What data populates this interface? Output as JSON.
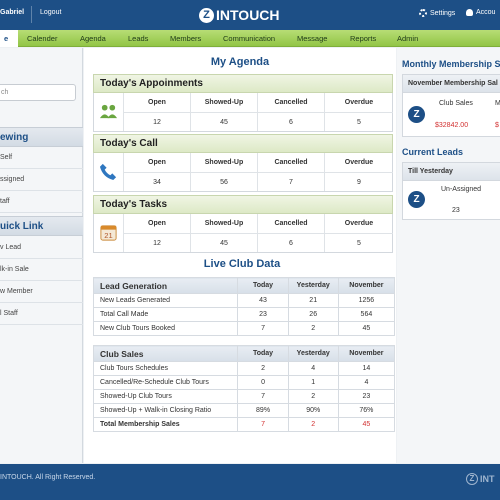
{
  "topbar": {
    "user": "Gabriel",
    "logout": "Logout",
    "logo_mark": "Z",
    "logo": "INTOUCH",
    "settings": "Settings",
    "account": "Accou"
  },
  "nav": [
    {
      "label": "e"
    },
    {
      "label": "Calender"
    },
    {
      "label": "Agenda"
    },
    {
      "label": "Leads"
    },
    {
      "label": "Members"
    },
    {
      "label": "Communication"
    },
    {
      "label": "Message"
    },
    {
      "label": "Reports"
    },
    {
      "label": "Admin"
    }
  ],
  "sidebar": {
    "search_placeholder": "ch",
    "viewing_title": "ewing",
    "viewing_items": [
      "Self",
      "ssigned",
      "taff"
    ],
    "quick_title": "uick Link",
    "quick_items": [
      "v Lead",
      "lk-in Sale",
      "w Member",
      "l Staff"
    ]
  },
  "main": {
    "title": "My Agenda",
    "appointments": {
      "title": "Today's Appoinments",
      "headers": [
        "Open",
        "Showed-Up",
        "Cancelled",
        "Overdue"
      ],
      "values": [
        "12",
        "45",
        "6",
        "5"
      ]
    },
    "calls": {
      "title": "Today's Call",
      "headers": [
        "Open",
        "Showed-Up",
        "Cancelled",
        "Overdue"
      ],
      "values": [
        "34",
        "56",
        "7",
        "9"
      ]
    },
    "tasks": {
      "title": "Today's Tasks",
      "headers": [
        "Open",
        "Showed-Up",
        "Cancelled",
        "Overdue"
      ],
      "values": [
        "12",
        "45",
        "6",
        "5"
      ],
      "calendar_day": "21"
    },
    "live_title": "Live Club Data",
    "lead_gen": {
      "headers": [
        "Lead Generation",
        "Today",
        "Yesterday",
        "November"
      ],
      "rows": [
        [
          "New Leads Generated",
          "43",
          "21",
          "1256"
        ],
        [
          "Total Call Made",
          "23",
          "26",
          "564"
        ],
        [
          "New Club Tours Booked",
          "7",
          "2",
          "45"
        ]
      ]
    },
    "club_sales": {
      "headers": [
        "Club Sales",
        "Today",
        "Yesterday",
        "November"
      ],
      "rows": [
        [
          "Club Tours Schedules",
          "2",
          "4",
          "14"
        ],
        [
          "Cancelled/Re-Schedule Club Tours",
          "0",
          "1",
          "4"
        ],
        [
          "Showed-Up Club Tours",
          "7",
          "2",
          "23"
        ],
        [
          "Showed-Up + Walk-in Closing Ratio",
          "89%",
          "90%",
          "76%"
        ]
      ],
      "total": [
        "Total Membership Sales",
        "7",
        "2",
        "45"
      ]
    }
  },
  "right": {
    "membership_title": "Monthly Membership Sal",
    "membership_box": {
      "head": "November Membership Sal",
      "label": "Club Sales",
      "label2": "M",
      "value": "$32842.00",
      "value2": "$"
    },
    "leads_title": "Current Leads",
    "leads_box": {
      "head": "Till Yesterday",
      "label": "Un-Assigned",
      "value": "23"
    }
  },
  "footer": {
    "copy": "INTOUCH. All Right Reserved.",
    "logo": "INT"
  },
  "colors": {
    "primary": "#1d4f86",
    "nav_green": "#92c546",
    "accent_red": "#d23030"
  }
}
